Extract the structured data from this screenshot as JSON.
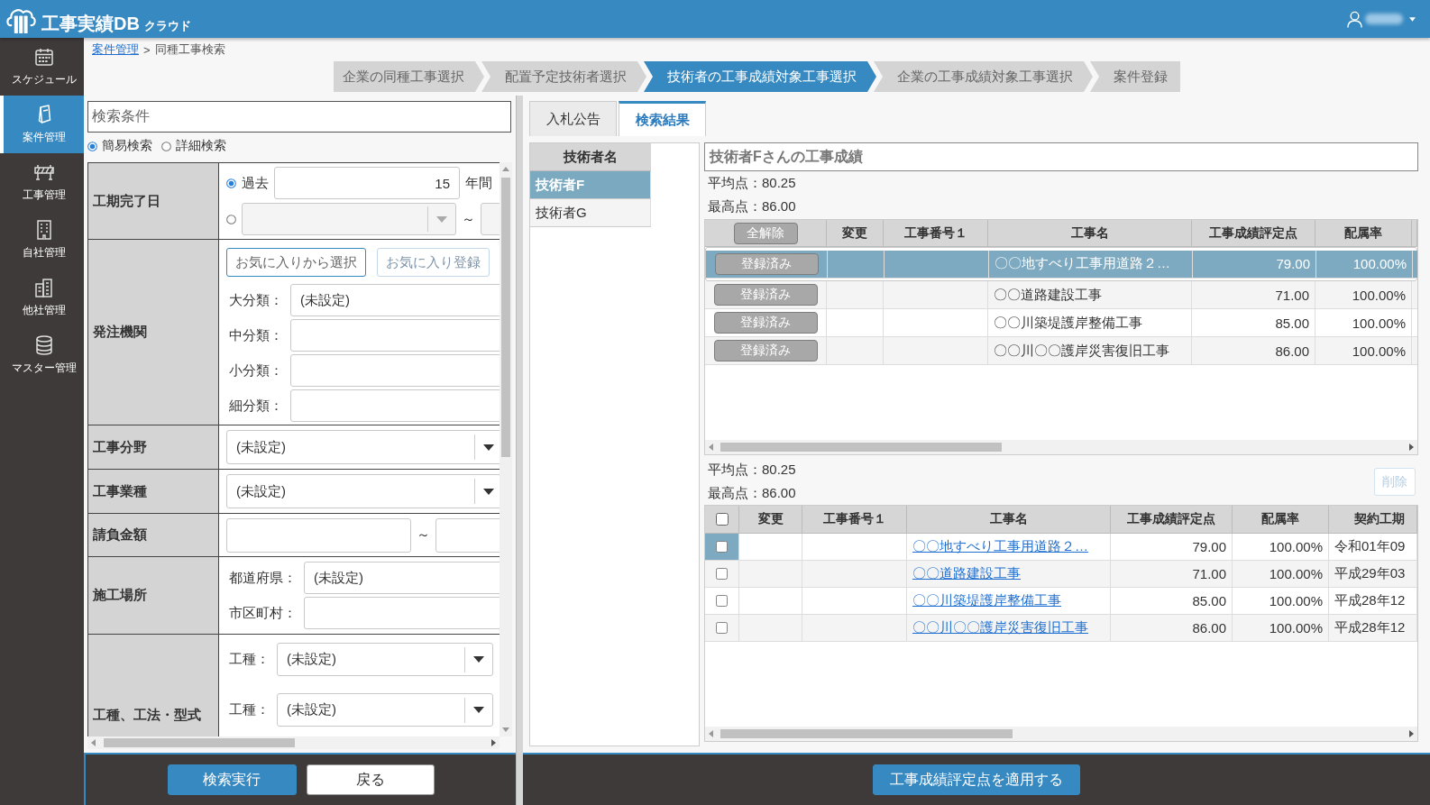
{
  "header": {
    "title": "工事実績DB",
    "subtitle": "クラウド"
  },
  "sidebar": {
    "items": [
      {
        "label": "スケジュール",
        "selected": false
      },
      {
        "label": "案件管理",
        "selected": true
      },
      {
        "label": "工事管理",
        "selected": false
      },
      {
        "label": "自社管理",
        "selected": false
      },
      {
        "label": "他社管理",
        "selected": false
      },
      {
        "label": "マスター管理",
        "selected": false
      }
    ]
  },
  "breadcrumb": {
    "separator": ">",
    "items": [
      {
        "label": "案件管理",
        "kind": "link"
      },
      {
        "label": "同種工事検索",
        "kind": "current"
      }
    ]
  },
  "steps": [
    {
      "label": "企業の同種工事選択",
      "selected": false
    },
    {
      "label": "配置予定技術者選択",
      "selected": false
    },
    {
      "label": "技術者の工事成績対象工事選択",
      "selected": true
    },
    {
      "label": "企業の工事成績対象工事選択",
      "selected": false
    },
    {
      "label": "案件登録",
      "selected": false
    }
  ],
  "search_panel": {
    "title": "検索条件",
    "modes": [
      {
        "label": "簡易検索",
        "selected": true
      },
      {
        "label": "詳細検索",
        "selected": false
      }
    ],
    "rows": [
      {
        "label": "工期完了日",
        "kind": "period",
        "options": [
          {
            "kind": "relative",
            "selected": true,
            "label": "過去",
            "value": "15",
            "unit": "年間"
          },
          {
            "kind": "range",
            "selected": false,
            "separator": "～"
          }
        ]
      },
      {
        "label": "発注機関",
        "kind": "agency",
        "buttons": [
          {
            "label": "お気に入りから選択",
            "disabled": false
          },
          {
            "label": "お気に入り登録",
            "disabled": true
          }
        ],
        "fields": [
          {
            "label": "大分類：",
            "value": "(未設定)"
          },
          {
            "label": "中分類："
          },
          {
            "label": "小分類："
          },
          {
            "label": "細分類："
          }
        ]
      },
      {
        "label": "工事分野",
        "kind": "select",
        "value": "(未設定)"
      },
      {
        "label": "工事業種",
        "kind": "select",
        "value": "(未設定)"
      },
      {
        "label": "請負金額",
        "kind": "range",
        "separator": "～"
      },
      {
        "label": "施工場所",
        "kind": "fields",
        "fields": [
          {
            "label": "都道府県：",
            "value": "(未設定)"
          },
          {
            "label": "市区町村："
          }
        ]
      },
      {
        "label": "工種、工法・型式",
        "kind": "selects",
        "fields": [
          {
            "label": "工種：",
            "value": "(未設定)"
          },
          {
            "label": "工種：",
            "value": "(未設定)"
          }
        ]
      }
    ],
    "buttons": [
      {
        "label": "検索実行",
        "kind": "search"
      },
      {
        "label": "戻る",
        "kind": "back"
      }
    ]
  },
  "result_panel": {
    "tabs": [
      {
        "label": "入札公告",
        "selected": false
      },
      {
        "label": "検索結果",
        "selected": true
      }
    ],
    "engineer_list": {
      "header": "技術者名",
      "items": [
        {
          "label": "技術者F",
          "selected": true
        },
        {
          "label": "技術者G",
          "selected": false
        }
      ]
    },
    "title": "技術者Fさんの工事成績",
    "candidate_works": {
      "stats": [
        "平均点：80.25",
        "最高点：86.00"
      ],
      "clear_button": "全解除",
      "columns": [
        "変更",
        "工事番号１",
        "工事名",
        "工事成績評定点",
        "配属率"
      ],
      "rows": [
        {
          "selected": true,
          "status": "登録済み",
          "name": "〇〇地すべり工事用道路２…",
          "score": "79.00",
          "ratio": "100.00%"
        },
        {
          "selected": false,
          "status": "登録済み",
          "name": "〇〇道路建設工事",
          "score": "71.00",
          "ratio": "100.00%"
        },
        {
          "selected": false,
          "status": "登録済み",
          "name": "〇〇川築堤護岸整備工事",
          "score": "85.00",
          "ratio": "100.00%"
        },
        {
          "selected": false,
          "status": "登録済み",
          "name": "〇〇川〇〇護岸災害復旧工事",
          "score": "86.00",
          "ratio": "100.00%"
        }
      ]
    },
    "registered_works": {
      "stats": [
        "平均点：80.25",
        "最高点：86.00"
      ],
      "delete_button": {
        "label": "削除",
        "disabled": true
      },
      "select_all": {
        "checked": false
      },
      "columns": [
        "変更",
        "工事番号１",
        "工事名",
        "工事成績評定点",
        "配属率",
        "契約工期"
      ],
      "rows": [
        {
          "selected": true,
          "checked": false,
          "name": "〇〇地すべり工事用道路２…",
          "score": "79.00",
          "ratio": "100.00%",
          "period": "令和01年09"
        },
        {
          "selected": false,
          "checked": false,
          "name": "〇〇道路建設工事",
          "score": "71.00",
          "ratio": "100.00%",
          "period": "平成29年03"
        },
        {
          "selected": false,
          "checked": false,
          "name": "〇〇川築堤護岸整備工事",
          "score": "85.00",
          "ratio": "100.00%",
          "period": "平成28年12"
        },
        {
          "selected": false,
          "checked": false,
          "name": "〇〇川〇〇護岸災害復旧工事",
          "score": "86.00",
          "ratio": "100.00%",
          "period": "平成28年12"
        }
      ]
    },
    "apply_button": "工事成績評定点を適用する"
  }
}
